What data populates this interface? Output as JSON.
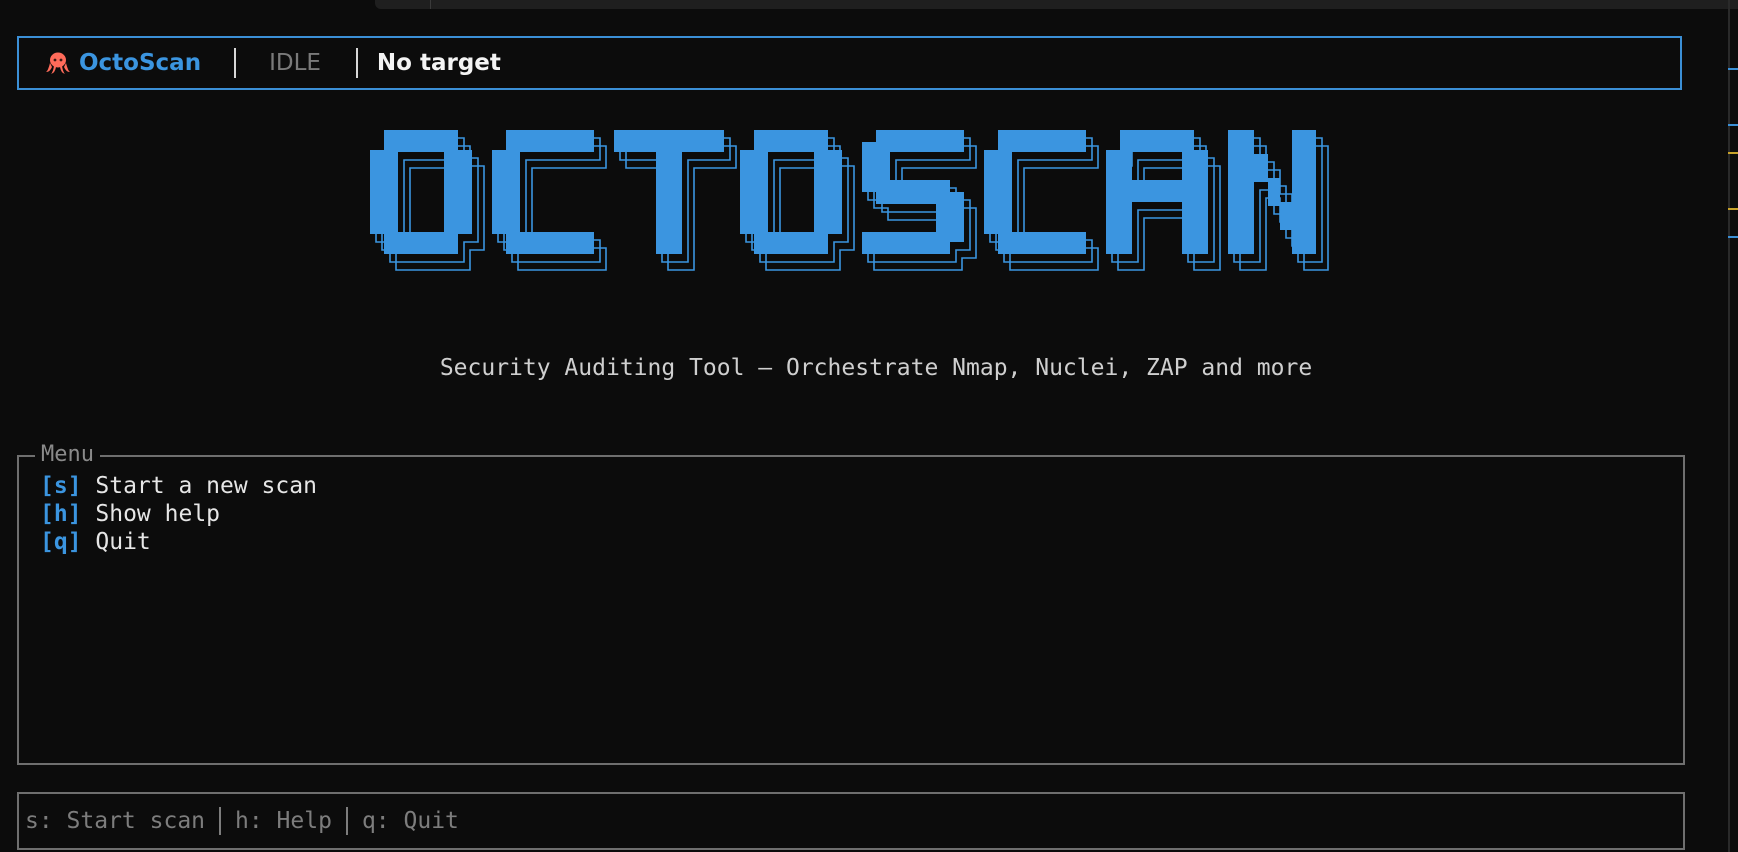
{
  "header": {
    "icon": "octopus-icon",
    "app_name": "OctoScan",
    "state": "IDLE",
    "target": "No target"
  },
  "banner": {
    "logo_text": "OCTOSCAN",
    "subtitle": "Security Auditing Tool – Orchestrate Nmap, Nuclei, ZAP and more"
  },
  "menu": {
    "title": "Menu",
    "items": [
      {
        "key": "[s]",
        "label": " Start a new scan"
      },
      {
        "key": "[h]",
        "label": " Show help"
      },
      {
        "key": "[q]",
        "label": " Quit"
      }
    ]
  },
  "footer": {
    "hints": [
      "s: Start scan",
      "h: Help",
      "q: Quit"
    ]
  },
  "colors": {
    "accent": "#3b95e0",
    "background": "#0c0c0c",
    "icon": "#ff6b5a",
    "muted": "#7d7d7d"
  }
}
